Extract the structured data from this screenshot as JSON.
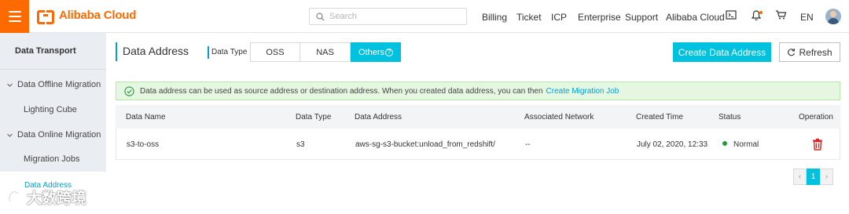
{
  "header": {
    "brand": "Alibaba Cloud",
    "search_placeholder": "Search",
    "nav": [
      "Billing",
      "Ticket",
      "ICP",
      "Enterprise",
      "Support",
      "Alibaba Cloud"
    ],
    "language": "EN",
    "icons": [
      "menu-icon",
      "search-icon",
      "terminal-icon",
      "bell-icon",
      "cart-icon",
      "avatar"
    ]
  },
  "sidebar": {
    "title": "Data Transport",
    "groups": [
      {
        "label": "Data Offline Migration",
        "items": [
          "Lighting Cube"
        ]
      },
      {
        "label": "Data Online Migration",
        "items": [
          "Migration Jobs",
          "Data Address"
        ]
      }
    ],
    "active_item": "Data Address"
  },
  "main": {
    "title": "Data Address",
    "type_label": "Data Type",
    "types": [
      "OSS",
      "NAS",
      "Others"
    ],
    "active_type": "Others",
    "create_button": "Create Data Address",
    "refresh_button": "Refresh",
    "notice": {
      "text": "Data address can be used as source address or destination address. When you created data address, you can then",
      "link": "Create Migration Job"
    },
    "table": {
      "columns": [
        "Data Name",
        "Data Type",
        "Data Address",
        "Associated Network",
        "Created Time",
        "Status",
        "Operation"
      ],
      "rows": [
        {
          "name": "s3-to-oss",
          "type": "s3",
          "address": "aws-sg-s3-bucket:unload_from_redshift/",
          "network": "--",
          "created": "July 02, 2020, 12:33",
          "status": "Normal"
        }
      ]
    },
    "pagination": {
      "current_page": "1",
      "prev": "‹",
      "next": "›"
    }
  },
  "watermark": "大数跨境",
  "colors": {
    "brand_orange": "#ff6a00",
    "accent_cyan": "#00c1de",
    "link_blue": "#00a1d6",
    "delete_red": "#e02020",
    "status_green": "#1e9e3a"
  }
}
